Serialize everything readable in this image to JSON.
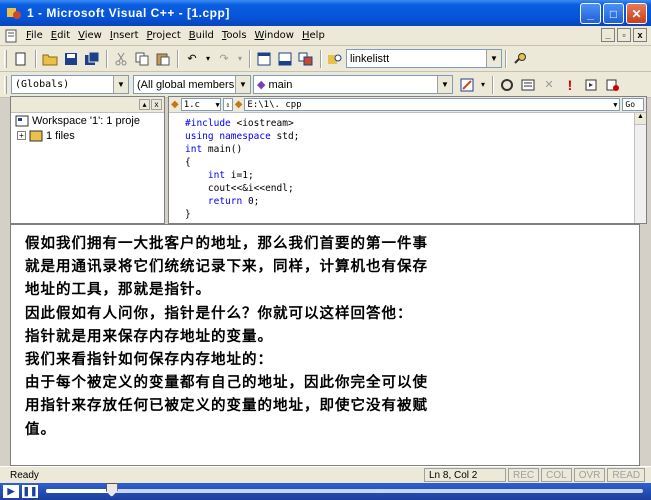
{
  "window": {
    "title": "1 - Microsoft Visual C++ - [1.cpp]"
  },
  "menu": [
    "File",
    "Edit",
    "View",
    "Insert",
    "Project",
    "Build",
    "Tools",
    "Window",
    "Help"
  ],
  "toolbar1": {
    "find_combo_value": "linkelistt"
  },
  "toolbar2": {
    "scope_combo": "(Globals)",
    "members_combo": "(All global members",
    "function_combo": "main"
  },
  "workspace": {
    "root_label": "Workspace '1': 1 proje",
    "child_label": "1 files"
  },
  "editor": {
    "file_combo": "1.c",
    "path_combo": "E:\\1\\. cpp",
    "code_lines": [
      {
        "pre": "",
        "kw": "#include",
        "post": " <iostream>"
      },
      {
        "pre": "",
        "kw": "using namespace",
        "post": " std;"
      },
      {
        "pre": "",
        "kw": "int",
        "post": " main()"
      },
      {
        "pre": "{",
        "kw": "",
        "post": ""
      },
      {
        "pre": "    ",
        "kw": "int",
        "post": " i=1;"
      },
      {
        "pre": "    cout<<&i<<endl;",
        "kw": "",
        "post": ""
      },
      {
        "pre": "    ",
        "kw": "return",
        "post": " 0;"
      },
      {
        "pre": "}",
        "kw": "",
        "post": ""
      }
    ]
  },
  "overlay": {
    "lines": [
      "假如我们拥有一大批客户的地址，那么我们首要的第一件事",
      "就是用通讯录将它们统统记录下来，同样，计算机也有保存",
      "地址的工具，那就是指针。",
      "因此假如有人问你，指针是什么？你就可以这样回答他：",
      "指针就是用来保存内存地址的变量。",
      "我们来看指针如何保存内存地址的：",
      "由于每个被定义的变量都有自己的地址，因此你完全可以使",
      "用指针来存放任何已被定义的变量的地址，即使它没有被赋",
      "值。"
    ]
  },
  "status": {
    "text": "Ready",
    "position": "Ln 8, Col 2",
    "rec": "REC",
    "col": "COL",
    "ovr": "OVR",
    "read": "READ"
  },
  "media": {
    "progress": 0.11
  }
}
